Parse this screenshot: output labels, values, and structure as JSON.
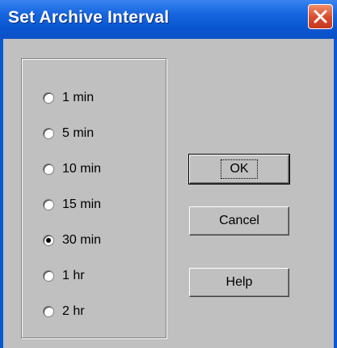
{
  "dialog": {
    "title": "Set Archive Interval",
    "close_icon": "close-icon"
  },
  "intervals": {
    "options": [
      "1 min",
      "5 min",
      "10 min",
      "15 min",
      "30 min",
      "1 hr",
      "2 hr"
    ],
    "selected": "30 min"
  },
  "buttons": {
    "ok_label": "OK",
    "cancel_label": "Cancel",
    "help_label": "Help"
  },
  "colors": {
    "title_bar": "#0a56d1",
    "close_button": "#d8492d",
    "dialog_face": "#c0c0c0"
  }
}
